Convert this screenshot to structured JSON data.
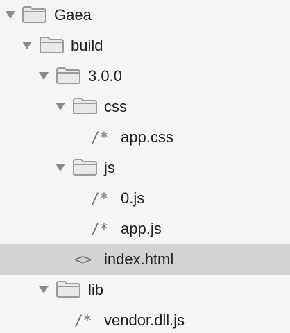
{
  "tree": {
    "root": {
      "label": "Gaea",
      "icon": "folder-icon",
      "expanded": true
    },
    "build": {
      "label": "build",
      "icon": "folder-icon",
      "expanded": true
    },
    "version": {
      "label": "3.0.0",
      "icon": "folder-icon",
      "expanded": true
    },
    "css": {
      "label": "css",
      "icon": "folder-icon",
      "expanded": true
    },
    "app_css": {
      "label": "app.css",
      "glyph": "/*",
      "icon": "comment-file-icon"
    },
    "js": {
      "label": "js",
      "icon": "folder-icon",
      "expanded": true
    },
    "zero_js": {
      "label": "0.js",
      "glyph": "/*",
      "icon": "comment-file-icon"
    },
    "app_js": {
      "label": "app.js",
      "glyph": "/*",
      "icon": "comment-file-icon"
    },
    "index_html": {
      "label": "index.html",
      "glyph": "<>",
      "icon": "html-file-icon",
      "selected": true
    },
    "lib": {
      "label": "lib",
      "icon": "folder-icon",
      "expanded": true
    },
    "vendor_js": {
      "label": "vendor.dll.js",
      "glyph": "/*",
      "icon": "comment-file-icon"
    }
  },
  "colors": {
    "background": "#f5f5f5",
    "selected_row": "#d3d3d3",
    "folder": "#9a9a9a",
    "twisty": "#8a8a8a",
    "text": "#1e1e1e"
  }
}
